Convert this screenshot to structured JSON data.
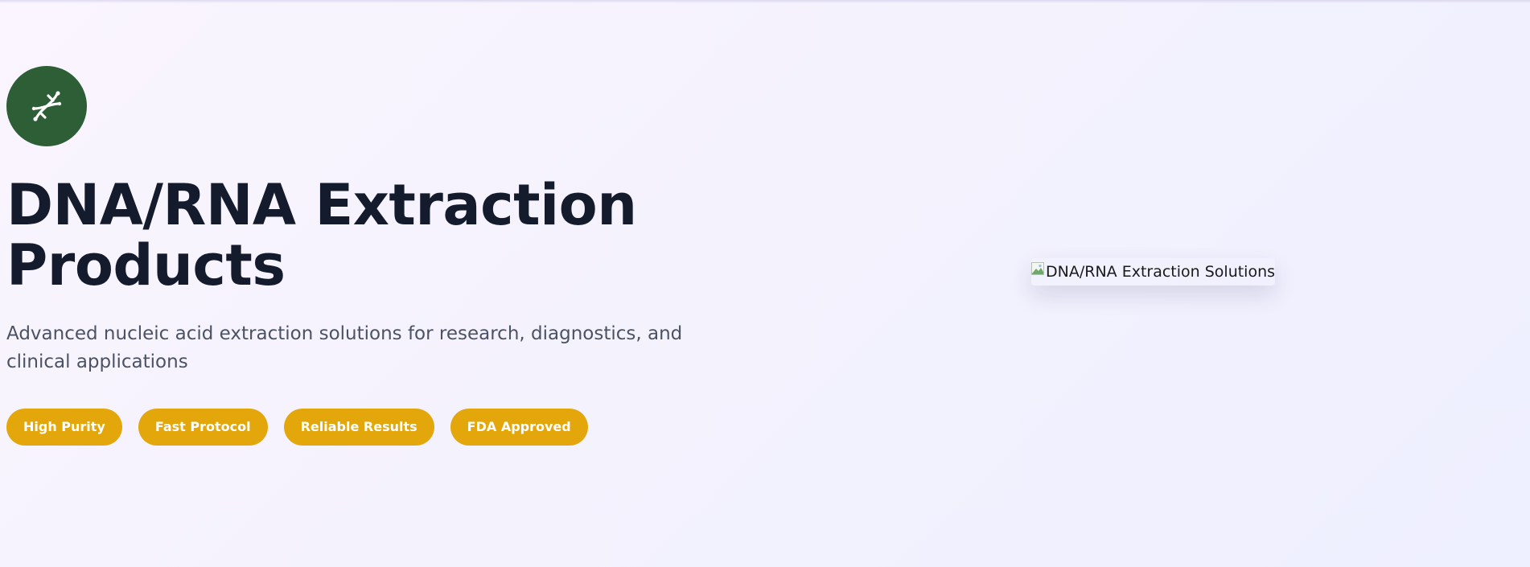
{
  "hero": {
    "logo_icon": "dna-icon",
    "title_line1": "DNA/RNA Extraction",
    "title_line2": "Products",
    "subtitle": "Advanced nucleic acid extraction solutions for research, diagnostics, and clinical applications",
    "badges": [
      {
        "label": "High Purity"
      },
      {
        "label": "Fast Protocol"
      },
      {
        "label": "Reliable Results"
      },
      {
        "label": "FDA Approved"
      }
    ],
    "image_alt": "DNA/RNA Extraction Solutions"
  },
  "colors": {
    "logo_background": "#2d5e36",
    "badge_background": "#e4a70b",
    "title_text": "#141b2d",
    "subtitle_text": "#4a5263"
  }
}
